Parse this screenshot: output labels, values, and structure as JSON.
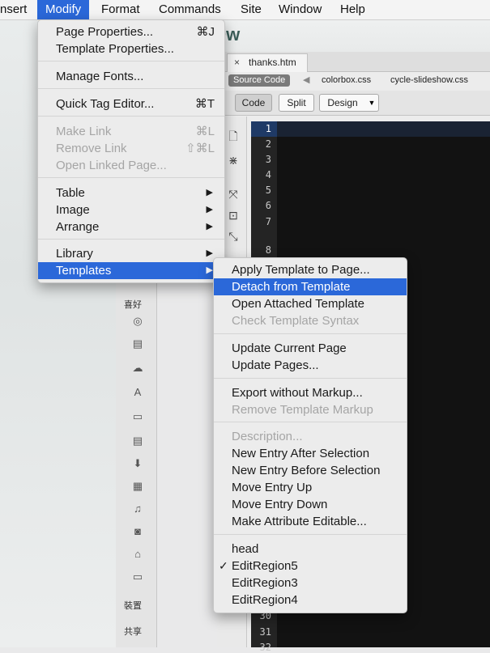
{
  "menubar": {
    "items": [
      "nsert",
      "Modify",
      "Format",
      "Commands",
      "Site",
      "Window",
      "Help"
    ]
  },
  "modify_menu": {
    "items": [
      {
        "label": "Page Properties...",
        "shortcut": "⌘J",
        "enabled": true
      },
      {
        "label": "Template Properties...",
        "shortcut": "",
        "enabled": true
      },
      {
        "label": "Manage Fonts...",
        "shortcut": "",
        "enabled": true
      },
      {
        "label": "Quick Tag Editor...",
        "shortcut": "⌘T",
        "enabled": true
      },
      {
        "label": "Make Link",
        "shortcut": "⌘L",
        "enabled": false
      },
      {
        "label": "Remove Link",
        "shortcut": "⇧⌘L",
        "enabled": false
      },
      {
        "label": "Open Linked Page...",
        "shortcut": "",
        "enabled": false
      },
      {
        "label": "Table",
        "submenu": true
      },
      {
        "label": "Image",
        "submenu": true
      },
      {
        "label": "Arrange",
        "submenu": true
      },
      {
        "label": "Library",
        "submenu": true
      },
      {
        "label": "Templates",
        "submenu": true,
        "highlighted": true
      }
    ]
  },
  "templates_menu": {
    "items": [
      {
        "label": "Apply Template to Page...",
        "enabled": true
      },
      {
        "label": "Detach from Template",
        "enabled": true,
        "highlighted": true
      },
      {
        "label": "Open Attached Template",
        "enabled": true
      },
      {
        "label": "Check Template Syntax",
        "enabled": false
      },
      {
        "label": "Update Current Page",
        "enabled": true
      },
      {
        "label": "Update Pages...",
        "enabled": true
      },
      {
        "label": "Export without Markup...",
        "enabled": true
      },
      {
        "label": "Remove Template Markup",
        "enabled": false
      },
      {
        "label": "Description...",
        "enabled": false
      },
      {
        "label": "New Entry After Selection",
        "enabled": true
      },
      {
        "label": "New Entry Before Selection",
        "enabled": true
      },
      {
        "label": "Move Entry Up",
        "enabled": true
      },
      {
        "label": "Move Entry Down",
        "enabled": true
      },
      {
        "label": "Make Attribute Editable...",
        "enabled": true
      },
      {
        "label": "head",
        "enabled": true
      },
      {
        "label": "EditRegion5",
        "enabled": true,
        "checked": true
      },
      {
        "label": "EditRegion3",
        "enabled": true
      },
      {
        "label": "EditRegion4",
        "enabled": true
      }
    ]
  },
  "document": {
    "tab": "thanks.htm",
    "tab_close": "×",
    "source_code": "Source Code",
    "related_files": [
      "colorbox.css",
      "cycle-slideshow.css"
    ],
    "views": {
      "code": "Code",
      "split": "Split",
      "design": "Design"
    },
    "line_numbers": [
      "1",
      "2",
      "3",
      "4",
      "5",
      "6",
      "7",
      "8",
      "29",
      "30",
      "31",
      "32"
    ]
  },
  "left_panel": {
    "labels": [
      "喜好",
      "裝置",
      "共享"
    ]
  },
  "background": {
    "logo_fragment": "Ow"
  },
  "colors": {
    "accent": "#2b68d9",
    "code_bg": "#121212",
    "tag": "#ff3d63"
  }
}
